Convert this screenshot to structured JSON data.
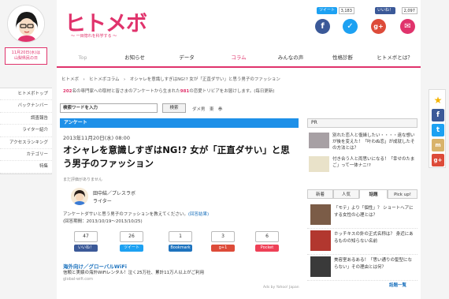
{
  "left": {
    "date_line1": "11月20日(水)は",
    "date_line2": "山梨県民の日",
    "nav": [
      "ヒトメボトップ",
      "バックナンバー",
      "調査報告",
      "ライター紹介",
      "アクセスランキング",
      "カテゴリー",
      "特集"
    ]
  },
  "header": {
    "logo": "ヒトメボ",
    "tagline": "〜 一目惚れを科学する 〜",
    "tweet_label": "ツイート",
    "tweet_count": "3,183",
    "like_label": "いいね！",
    "like_count": "2,097"
  },
  "topnav": [
    "Top",
    "お知らせ",
    "データ",
    "コラム",
    "みんなの声",
    "性格診断",
    "ヒトメボとは？"
  ],
  "breadcrumb": "ヒトメボ　›　ヒトメボコラム　›　オシャレを意識しすぎはNG!? 女が「正直ダサい」と思う男子のファッション",
  "notice": {
    "n1": "202",
    "t1": "名の専門家への取材と皆さまのアンケートから生まれた",
    "n2": "981",
    "t2": "の恋愛トリビアをお届けします。(毎日更新)"
  },
  "search": {
    "placeholder": "検索ワードを入力",
    "button": "検索",
    "tags": "ダメ男　東　拳"
  },
  "article": {
    "category": "アンケート",
    "date": "2013年11月20日(水) 08:00",
    "title": "オシャレを意識しすぎはNG!? 女が「正直ダサい」と思う男子のファッション",
    "rating": "まだ評価がありません",
    "author_name": "田中結／プレスラボ",
    "author_role": "ライター",
    "summary": "アンケートダサいと思う男子のファッションを教えてください。",
    "summary_link": "(回答結果)",
    "period": "(回答期間：2013/10/19〜2013/10/25)"
  },
  "share": [
    {
      "count": "47",
      "label": "いいね！",
      "color": "#3b5998"
    },
    {
      "count": "26",
      "label": "ツイート",
      "color": "#1da1f2"
    },
    {
      "count": "1",
      "label": "Bookmark",
      "color": "#1e73be"
    },
    {
      "count": "3",
      "label": "g+1",
      "color": "#dd4b39"
    },
    {
      "count": "6",
      "label": "Pocket",
      "color": "#ee4056"
    }
  ],
  "ad": {
    "title": "海外向け／グローバルWiFi",
    "desc": "信頼と実績の海外WiFiレンタル！泣く25万社、累計11万人以上がご利用",
    "url": "global-wifi.com",
    "note": "Ads by Yahoo! Japan"
  },
  "pr": {
    "head": "PR",
    "items": [
      "別れた恋人と復縁したい・・・・遠な想いが後を変えた！「叶わぬ恋」が成就したその方法とは？",
      "付き合う人と両思いになる！「幸せのたまご」って一体ナニ!?"
    ]
  },
  "tabs": [
    "新着",
    "人気",
    "話題",
    "Pick up!"
  ],
  "ranking": [
    "「モテ」より「個性」？ ショートヘアにする女性の心理とは？",
    "ホッチキスの針の正式名称は？ 身近にあるものの知らない名前",
    "美容室あるある！「思い通りの髪型にならない」その理由とは何？"
  ],
  "ranking_list": "話題一覧",
  "colors": {
    "brand": "#e0336c",
    "accent": "#1e90e8"
  }
}
